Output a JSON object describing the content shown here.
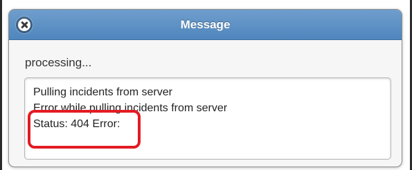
{
  "dialog": {
    "title": "Message",
    "close_icon": "close-icon",
    "status_text": "processing...",
    "log_lines": [
      "Pulling incidents from server",
      " Error while pulling incidents from server",
      "Status: 404 Error:"
    ]
  },
  "colors": {
    "titlebar": "#5b8fc6",
    "highlight": "#e31b23"
  }
}
